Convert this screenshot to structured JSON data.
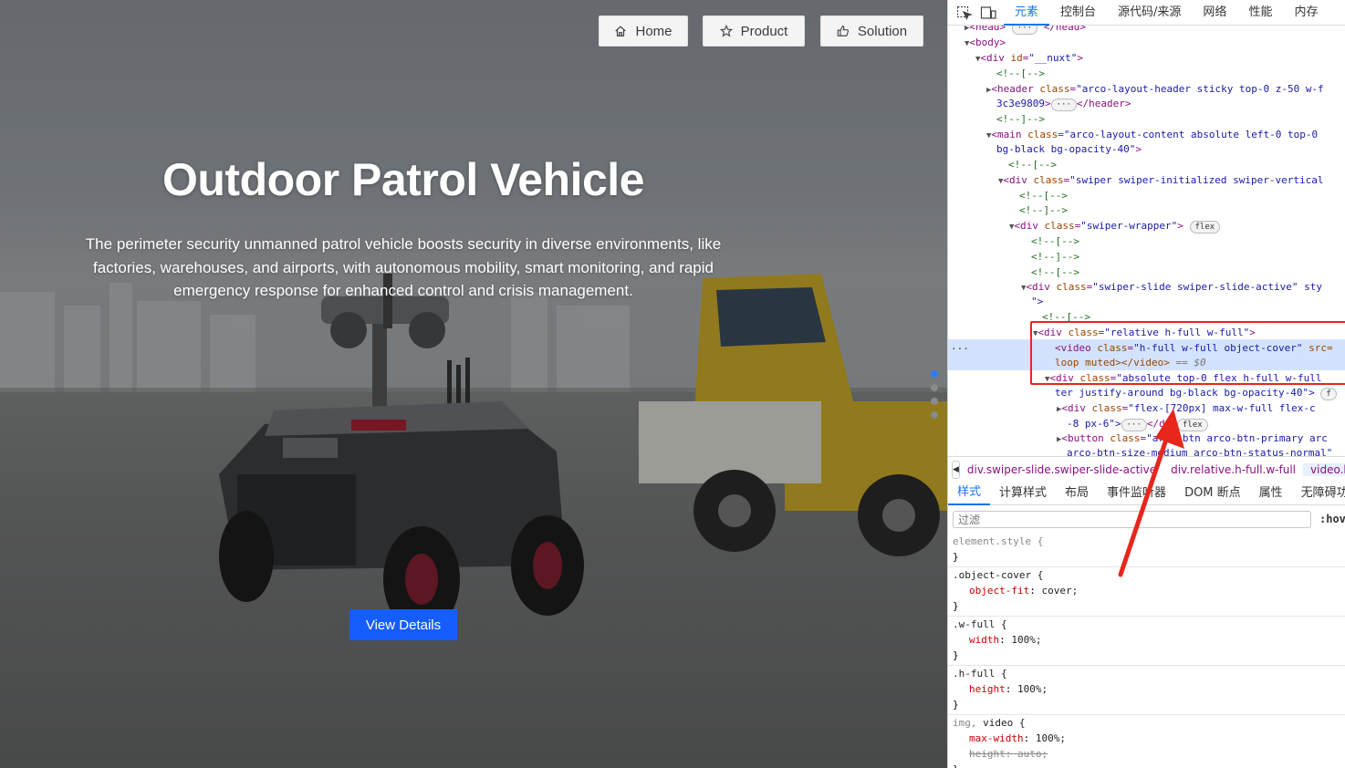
{
  "hero": {
    "nav": [
      {
        "label": "Home",
        "icon": "home-icon"
      },
      {
        "label": "Product",
        "icon": "star-icon"
      },
      {
        "label": "Solution",
        "icon": "thumbs-up-icon"
      }
    ],
    "title": "Outdoor Patrol Vehicle",
    "description": "The perimeter security unmanned patrol vehicle boosts security in diverse environments, like factories, warehouses, and airports, with autonomous mobility, smart monitoring, and rapid emergency response for enhanced control and crisis management.",
    "cta_label": "View Details",
    "slides_total": 4,
    "slide_active": 1
  },
  "devtools": {
    "tabs": [
      "元素",
      "控制台",
      "源代码/来源",
      "网络",
      "性能",
      "内存"
    ],
    "active_tab": "元素",
    "dom": {
      "l1_open": "<head>",
      "l1_close": "</head>",
      "l2": "<body>",
      "l3_tag": "<div ",
      "l3_an": "id",
      "l3_av": "\"__nuxt\"",
      "cm_open": "<!--[-->",
      "cm_close": "<!--]-->",
      "hdr_tag": "<header ",
      "hdr_an": "class",
      "hdr_av": "\"arco-layout-header sticky top-0 z-50 w-f",
      "hdr2_av": "3c3e9809",
      "hdr2_close": "</header>",
      "main_tag": "<main ",
      "main_av": "\"arco-layout-content absolute left-0 top-0",
      "main2_av": "bg-black bg-opacity-40\"",
      "swiper_av": "\"swiper swiper-initialized swiper-vertical",
      "wrapper_av": "\"swiper-wrapper\"",
      "flex": "flex",
      "slide_av": "\"swiper-slide swiper-slide-active\" sty",
      "slide2": "\">",
      "rel_av": "\"relative h-full w-full\"",
      "video_tag": "<video ",
      "video_av": "\"h-full w-full object-cover\"",
      "video_an2": " src=",
      "video2": "loop muted></video>",
      "video2_eq": "== $0",
      "abs_av": "\"absolute top-0 flex h-full w-full",
      "abs2": "ter justify-around bg-black bg-opacity-40\">",
      "inner_av": "\"flex-[720px] max-w-full flex-c",
      "inner2": "-8 px-6\">",
      "inner2_close": "</d",
      "btn_tag": "<button ",
      "btn_av": "\"arco-btn arco-btn-primary arc",
      "btn2": "arco-btn-size-medium arco-btn-status-normal\"",
      "ellipsis_row": "···"
    },
    "breadcrumb": [
      "div.swiper-slide.swiper-slide-active",
      "div.relative.h-full.w-full",
      "video.h-fu"
    ],
    "subtabs": [
      "样式",
      "计算样式",
      "布局",
      "事件监听器",
      "DOM 断点",
      "属性",
      "无障碍功"
    ],
    "active_subtab": "样式",
    "filter_placeholder": "过滤",
    "hov": ":hov",
    "rules": [
      {
        "selector": "element.style {",
        "props": []
      },
      {
        "selector": ".object-cover {",
        "props": [
          {
            "name": "object-fit",
            "value": "cover;"
          }
        ]
      },
      {
        "selector": ".w-full {",
        "props": [
          {
            "name": "width",
            "value": "100%;"
          }
        ]
      },
      {
        "selector": ".h-full {",
        "props": [
          {
            "name": "height",
            "value": "100%;"
          }
        ]
      },
      {
        "selector_dim": "img,",
        "selector": " video {",
        "props": [
          {
            "name": "max-width",
            "value": "100%;"
          },
          {
            "name": "height",
            "value": "auto;",
            "struck": true
          }
        ]
      }
    ],
    "close_brace": "}"
  },
  "colors": {
    "primary": "#165dff",
    "devtools_accent": "#1a73e8",
    "annotation": "#e8261c"
  }
}
